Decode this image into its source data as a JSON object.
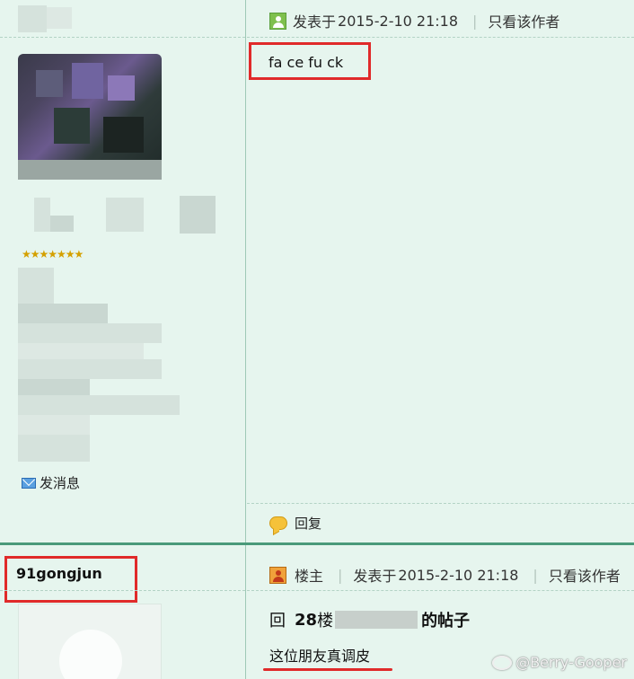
{
  "post1": {
    "posted_label": "发表于",
    "date": "2015-2-10 21:18",
    "author_only": "只看该作者",
    "content": "fa ce fu ck",
    "reply_label": "回复",
    "stars": "★★★★★★★",
    "message_label": "发消息"
  },
  "post2": {
    "username": "91gongjun",
    "host_label": "楼主",
    "posted_label": "发表于",
    "date": "2015-2-10 21:18",
    "author_only": "只看该作者",
    "reply_prefix": "回",
    "floor_number": "28",
    "floor_suffix": "楼",
    "post_suffix": "的帖子",
    "content": "这位朋友真调皮"
  },
  "watermark": "@Berry-Gooper",
  "colors": {
    "background": "#e6f5ee",
    "highlight": "#e02a2a",
    "divider": "#4a9a7a"
  },
  "icons": [
    "user-icon",
    "mail-icon",
    "reply-bubble-icon",
    "host-icon",
    "weibo-icon"
  ]
}
